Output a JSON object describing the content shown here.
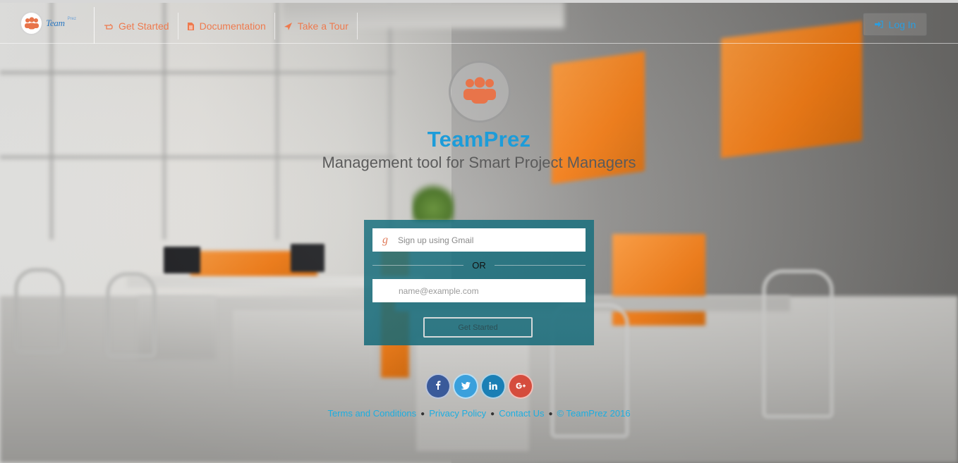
{
  "brand": {
    "logo_text": "Team",
    "logo_sub": "Prez",
    "logo_tagline": ""
  },
  "nav": {
    "items": [
      {
        "label": "Get Started",
        "icon": "hand-pointer-icon"
      },
      {
        "label": "Documentation",
        "icon": "document-icon"
      },
      {
        "label": "Take a Tour",
        "icon": "plane-icon"
      }
    ]
  },
  "header": {
    "login_label": "Log In",
    "login_icon": "sign-in-icon"
  },
  "hero": {
    "icon": "team-icon",
    "title": "TeamPrez",
    "subtitle": "Management tool for Smart Project Managers"
  },
  "signup": {
    "gmail_icon": "google-g-icon",
    "gmail_label": "Sign up using Gmail",
    "or_label": "OR",
    "email_placeholder": "name@example.com",
    "submit_label": "Get Started"
  },
  "social": [
    {
      "name": "facebook",
      "glyph": "f"
    },
    {
      "name": "twitter",
      "glyph": "t"
    },
    {
      "name": "linkedin",
      "glyph": "in"
    },
    {
      "name": "google-plus",
      "glyph": "g+"
    }
  ],
  "footer": {
    "links": [
      "Terms and Conditions",
      "Privacy Policy",
      "Contact Us"
    ],
    "copyright": "© TeamPrez 2016"
  },
  "colors": {
    "accent_blue": "#1d9cd9",
    "nav_orange": "#ee7a4e",
    "panel_teal": "#146e7d",
    "logo_orange": "#e8744a"
  }
}
